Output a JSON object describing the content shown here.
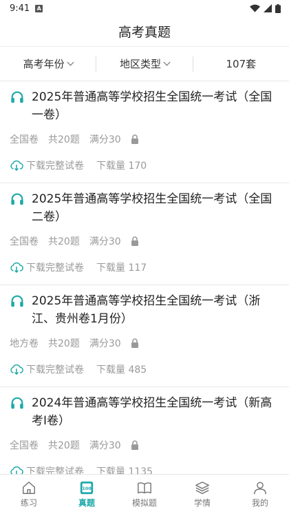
{
  "status": {
    "time": "9:41",
    "notif": "A"
  },
  "header": {
    "title": "高考真题"
  },
  "filters": {
    "year": "高考年份",
    "region": "地区类型",
    "count": "107套"
  },
  "accent": "#1fa9a9",
  "papers": [
    {
      "title": "2025年普通高等学校招生全国统一考试（全国一卷）",
      "type": "全国卷",
      "questions": "共20题",
      "score": "满分30",
      "download": "下载完整试卷",
      "downloads": "下载量 170"
    },
    {
      "title": "2025年普通高等学校招生全国统一考试（全国二卷）",
      "type": "全国卷",
      "questions": "共20题",
      "score": "满分30",
      "download": "下载完整试卷",
      "downloads": "下载量 117"
    },
    {
      "title": "2025年普通高等学校招生全国统一考试（浙江、贵州卷1月份）",
      "type": "地方卷",
      "questions": "共20题",
      "score": "满分30",
      "download": "下载完整试卷",
      "downloads": "下载量 485"
    },
    {
      "title": "2024年普通高等学校招生全国统一考试（新高考Ⅰ卷）",
      "type": "全国卷",
      "questions": "共20题",
      "score": "满分30",
      "download": "下载完整试卷",
      "downloads": "下载量 1135"
    }
  ],
  "tabs": [
    {
      "label": "练习",
      "icon": "home-icon"
    },
    {
      "label": "真题",
      "icon": "exam-book-icon"
    },
    {
      "label": "模拟题",
      "icon": "open-book-icon"
    },
    {
      "label": "学情",
      "icon": "layers-icon"
    },
    {
      "label": "我的",
      "icon": "user-icon"
    }
  ]
}
